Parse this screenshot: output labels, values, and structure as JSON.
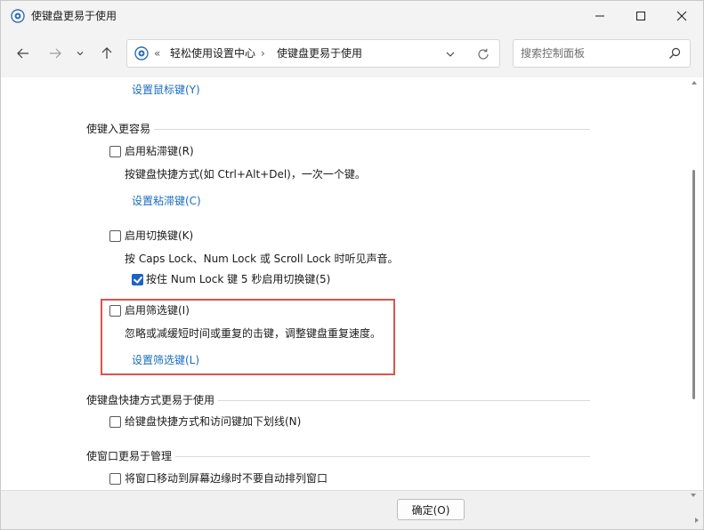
{
  "window": {
    "title": "使键盘更易于使用",
    "icon": "control-panel-icon"
  },
  "nav": {
    "back_icon": "arrow-left-icon",
    "forward_icon": "arrow-right-icon",
    "recent_icon": "chevron-down-icon",
    "up_icon": "arrow-up-icon"
  },
  "address": {
    "overflow": "«",
    "crumbs": [
      "轻松使用设置中心",
      "使键盘更易于使用"
    ],
    "separator": "›"
  },
  "search": {
    "placeholder": "搜索控制面板"
  },
  "content": {
    "top_link": "设置鼠标键(Y)",
    "section_typing": {
      "heading": "使键入更容易",
      "sticky": {
        "label": "启用粘滞键(R)",
        "checked": false,
        "desc": "按键盘快捷方式(如 Ctrl+Alt+Del)，一次一个键。",
        "link": "设置粘滞键(C)"
      },
      "toggle": {
        "label": "启用切换键(K)",
        "checked": false,
        "desc": "按 Caps Lock、Num Lock 或 Scroll Lock 时听见声音。",
        "sub_label": "按住 Num Lock 键 5 秒启用切换键(5)",
        "sub_checked": true
      },
      "filter": {
        "label": "启用筛选键(I)",
        "checked": false,
        "desc": "忽略或减缓短时间或重复的击键，调整键盘重复速度。",
        "link": "设置筛选键(L)"
      }
    },
    "section_shortcuts": {
      "heading": "使键盘快捷方式更易于使用",
      "underline": {
        "label": "给键盘快捷方式和访问键加下划线(N)",
        "checked": false
      }
    },
    "section_windows": {
      "heading": "使窗口更易于管理",
      "snap": {
        "label": "将窗口移动到屏幕边缘时不要自动排列窗口",
        "checked": false
      }
    }
  },
  "footer": {
    "ok_label": "确定(O)"
  },
  "colors": {
    "link": "#1a6dbd",
    "highlight": "#d9534f",
    "checkbox_checked": "#1b64c4"
  }
}
